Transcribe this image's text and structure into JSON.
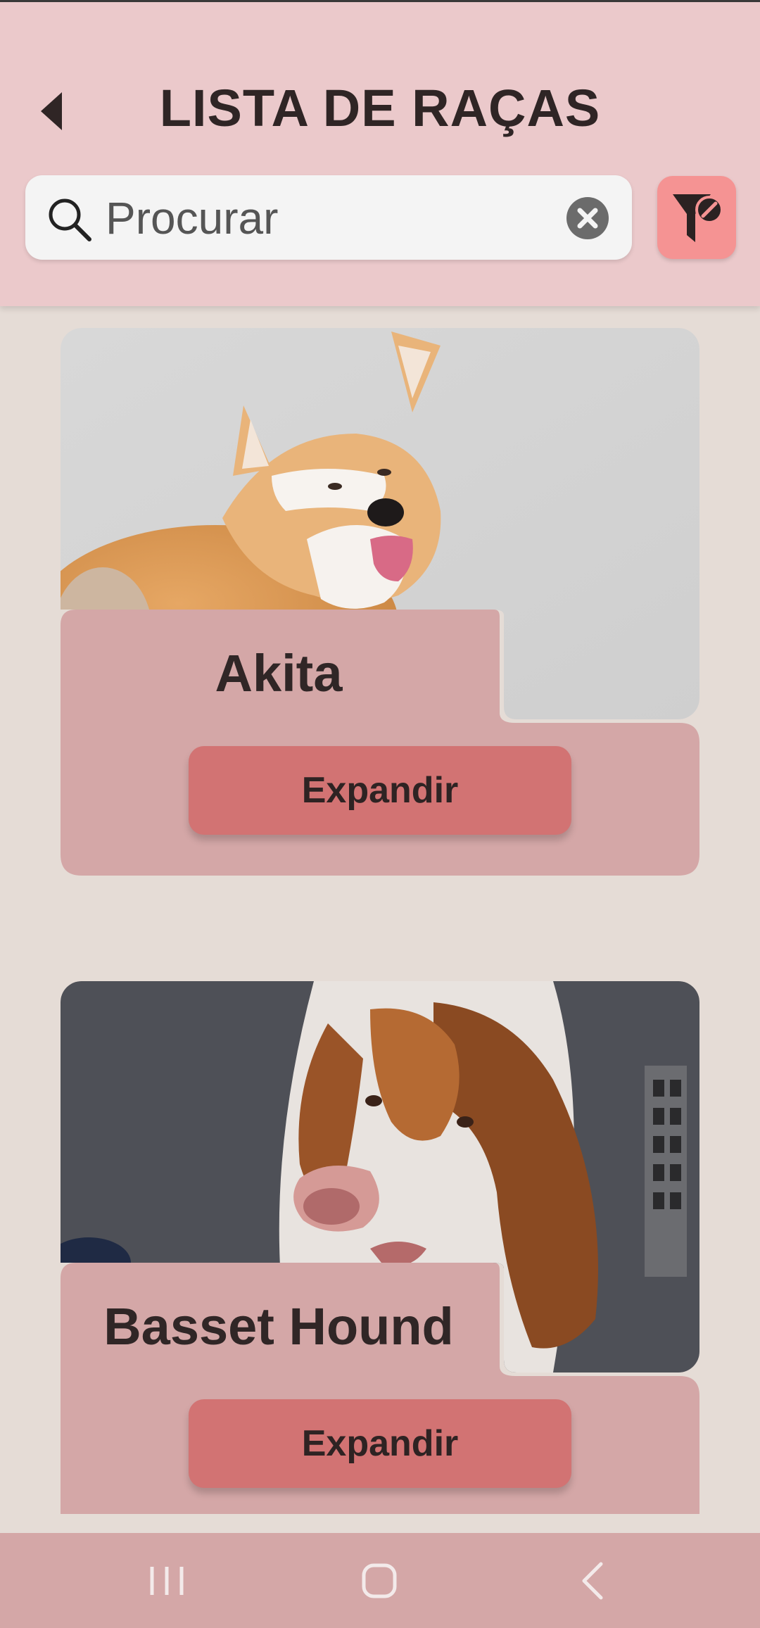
{
  "header": {
    "title": "LISTA DE RAÇAS",
    "back_icon": "back-arrow-icon"
  },
  "search": {
    "placeholder": "Procurar",
    "value": "",
    "search_icon": "search-icon",
    "clear_icon": "clear-icon"
  },
  "filter": {
    "icon": "filter-off-icon",
    "color": "#f59393"
  },
  "breeds": [
    {
      "name": "Akita",
      "button_label": "Expandir"
    },
    {
      "name": "Basset Hound",
      "button_label": "Expandir"
    }
  ],
  "colors": {
    "header_bg": "#ebc9cb",
    "page_bg": "#e5dcd6",
    "card_panel": "#d4a7a7",
    "button": "#d27373",
    "nav_bar": "#d4a7a7"
  },
  "navbar": {
    "items": [
      {
        "icon": "recent-apps-icon"
      },
      {
        "icon": "home-icon"
      },
      {
        "icon": "back-icon"
      }
    ]
  }
}
